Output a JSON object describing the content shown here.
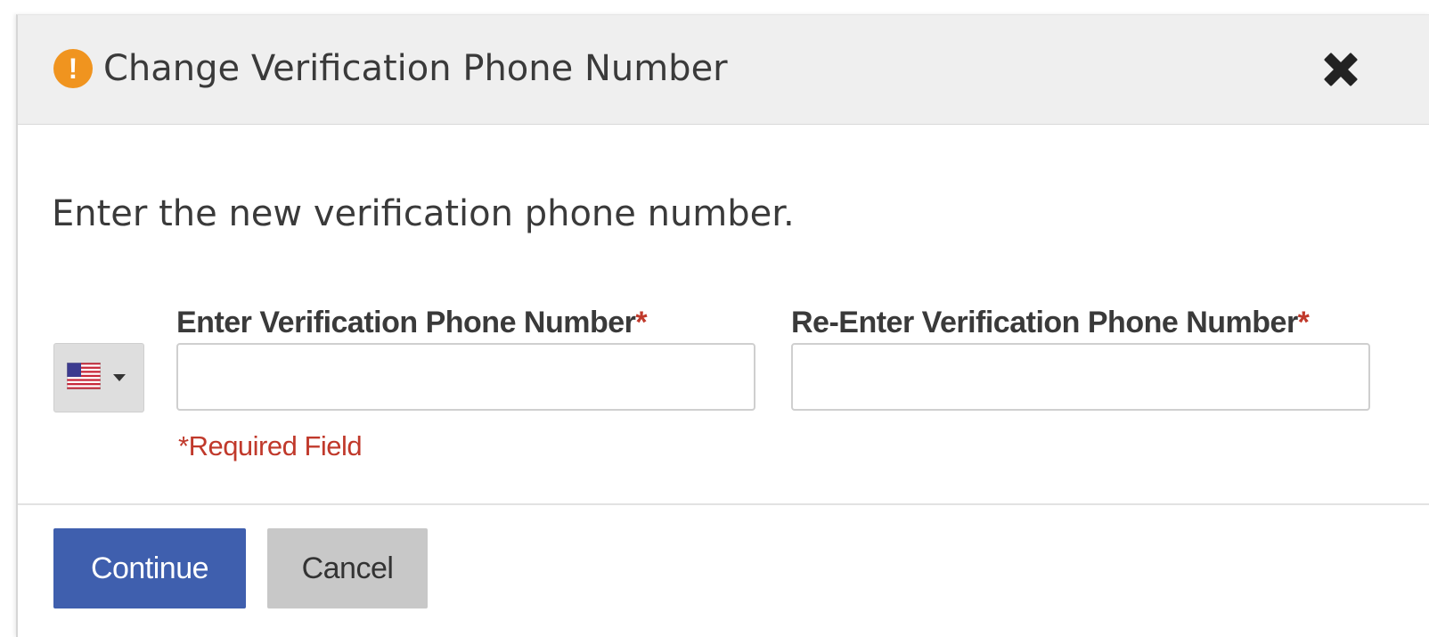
{
  "dialog": {
    "title": "Change Verification Phone Number",
    "alert_icon": "exclamation-circle-icon",
    "alert_symbol": "!",
    "close_icon": "close-icon"
  },
  "form": {
    "intro": "Enter the new verification phone number.",
    "country_selector": {
      "selected_flag": "us-flag-icon",
      "caret_icon": "caret-down-icon"
    },
    "phone": {
      "label": "Enter Verification Phone Number",
      "required_marker": "*",
      "value": ""
    },
    "phone_confirm": {
      "label": "Re-Enter Verification Phone Number",
      "required_marker": "*",
      "value": ""
    },
    "required_note": "*Required Field"
  },
  "footer": {
    "continue_label": "Continue",
    "cancel_label": "Cancel"
  },
  "colors": {
    "header_bg": "#efefef",
    "alert": "#f0941f",
    "required": "#c0392b",
    "primary_button": "#3f5fae",
    "secondary_button": "#c8c8c8"
  }
}
